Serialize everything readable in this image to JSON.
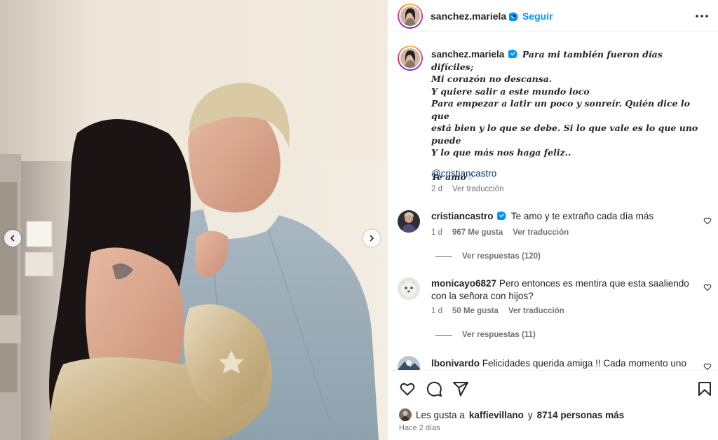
{
  "post": {
    "username": "sanchez.mariela",
    "separator": "•",
    "follow_label": "Seguir"
  },
  "caption": {
    "username": "sanchez.mariela",
    "lines": [
      "Para mi también fueron días difíciles;",
      "Mi corazón no descansa.",
      "Y quiere salir a este mundo loco",
      "Para empezar a latir un poco y sonreír. Quién dice lo que",
      "está bien y lo que se debe. Si lo que vale es lo que uno",
      "puede",
      "Y lo que más nos haga feliz..",
      "",
      "Te amo♡"
    ],
    "mention": "@cristiancastro",
    "time": "2 d",
    "translate_label": "Ver traducción"
  },
  "comments": [
    {
      "username": "cristiancastro",
      "verified": true,
      "text": "Te amo y te extraño cada día más",
      "time": "1 d",
      "likes": "967 Me gusta",
      "translate_label": "Ver traducción",
      "replies_label": "Ver respuestas (120)"
    },
    {
      "username": "monicayo6827",
      "verified": false,
      "text": "Pero entonces es mentira que esta saaliendo con la señora con hijos?",
      "time": "1 d",
      "likes": "50 Me gusta",
      "translate_label": "Ver traducción",
      "replies_label": "Ver respuestas (11)"
    },
    {
      "username": "lbonivardo",
      "verified": false,
      "text": "Felicidades querida amiga !! Cada momento uno"
    }
  ],
  "actions": {
    "icons": [
      "heart-icon",
      "comment-icon",
      "share-icon",
      "bookmark-icon"
    ]
  },
  "likes_summary": {
    "prefix": "Les gusta a",
    "first_user": "kaffievillano",
    "connector": "y",
    "others": "8714 personas más"
  },
  "time_ago": "Hace 2 días",
  "colors": {
    "link_blue": "#0095f6",
    "mention_blue": "#00376b",
    "verified_blue": "#0095f6",
    "muted": "#737373"
  }
}
